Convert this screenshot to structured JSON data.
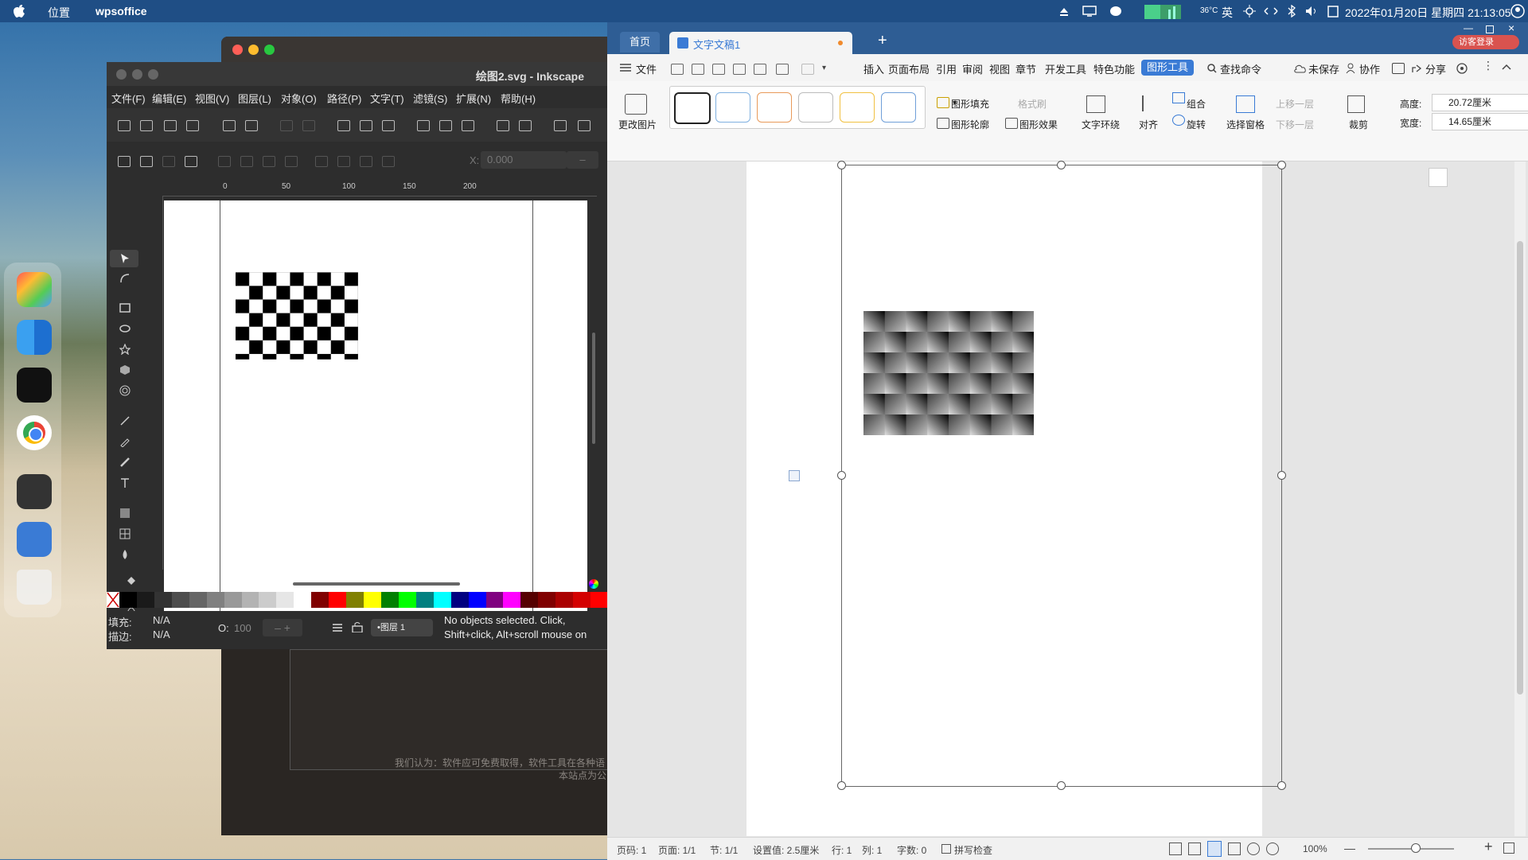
{
  "topbar": {
    "location": "位置",
    "app": "wpsoffice",
    "temperature": "36°C",
    "ime": "英",
    "datetime": "2022年01月20日 星期四 21:13:05"
  },
  "dock": {
    "items": [
      "launchpad-icon",
      "finder-icon",
      "terminal-icon",
      "chrome-icon",
      "inkscape-icon",
      "wps-icon",
      "trash-icon"
    ]
  },
  "bgwindow": {
    "text1": "我们认为：软件应可免费取得，软件工具在各种语",
    "text2": "本站点为公"
  },
  "inkscape": {
    "title": "绘图2.svg - Inkscape",
    "menu": [
      "文件(F)",
      "编辑(E)",
      "视图(V)",
      "图层(L)",
      "对象(O)",
      "路径(P)",
      "文字(T)",
      "滤镜(S)",
      "扩展(N)",
      "帮助(H)"
    ],
    "x_label": "X:",
    "x_value": "0.000",
    "ruler": [
      "0",
      "50",
      "100",
      "150",
      "200"
    ],
    "fill_label": "填充:",
    "fill_value": "N/A",
    "stroke_label": "描边:",
    "stroke_value": "N/A",
    "opacity_label": "O:",
    "opacity_value": "100",
    "layer": "•图层 1",
    "status_line1": "No objects selected. Click,",
    "status_line2": "Shift+click, Alt+scroll mouse on",
    "palette": [
      "#000000",
      "#1a1a1a",
      "#333333",
      "#4d4d4d",
      "#666666",
      "#808080",
      "#999999",
      "#b3b3b3",
      "#cccccc",
      "#e6e6e6",
      "#ffffff",
      "#800000",
      "#ff0000",
      "#808000",
      "#ffff00",
      "#008000",
      "#00ff00",
      "#008080",
      "#00ffff",
      "#000080",
      "#0000ff",
      "#800080",
      "#ff00ff",
      "#550000",
      "#800000",
      "#aa0000",
      "#d40000",
      "#ff0000"
    ]
  },
  "wps": {
    "tab_home": "首页",
    "tab_doc": "文字文稿1",
    "login": "访客登录",
    "menu": {
      "file": "文件",
      "insert": "插入",
      "layout": "页面布局",
      "refs": "引用",
      "review": "审阅",
      "view": "视图",
      "chapter": "章节",
      "dev": "开发工具",
      "special": "特色功能",
      "graphics": "图形工具",
      "search": "查找命令",
      "unsaved": "未保存",
      "collab": "协作",
      "share": "分享"
    },
    "ribbon": {
      "change_pic": "更改图片",
      "shape_fill": "图形填充",
      "format_brush": "格式刷",
      "shape_outline": "图形轮廓",
      "shape_effect": "图形效果",
      "text_wrap": "文字环绕",
      "align": "对齐",
      "group": "组合",
      "rotate": "旋转",
      "select_pane": "选择窗格",
      "bring_forward": "上移一层",
      "send_backward": "下移一层",
      "crop": "裁剪",
      "height_label": "高度:",
      "height_value": "20.72厘米",
      "width_label": "宽度:",
      "width_value": "14.65厘米",
      "style_colors": [
        "#222222",
        "#7fb0e0",
        "#e89a5a",
        "#bbbbbb",
        "#f0c040",
        "#6f9fd8"
      ]
    },
    "status": {
      "page_num": "页码: 1",
      "pages": "页面: 1/1",
      "section": "节: 1/1",
      "setting": "设置值: 2.5厘米",
      "row": "行: 1",
      "col": "列: 1",
      "words": "字数: 0",
      "spell": "拼写检查",
      "zoom": "100%"
    }
  }
}
